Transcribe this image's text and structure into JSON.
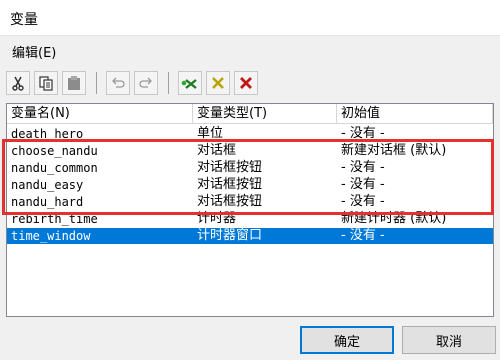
{
  "window": {
    "title": "变量"
  },
  "menu": {
    "edit": "编辑(E)"
  },
  "toolbar": {
    "buttons": [
      {
        "name": "cut-icon",
        "color": "#333333"
      },
      {
        "name": "copy-icon",
        "color": "#333333"
      },
      {
        "name": "paste-icon",
        "color": "#909090"
      },
      {
        "name": "undo-icon",
        "color": "#9a9a9a"
      },
      {
        "name": "redo-icon",
        "color": "#9a9a9a"
      },
      {
        "name": "new-variable-icon",
        "color": "#2a8a2a"
      },
      {
        "name": "delete-variable-icon",
        "color": "#b8a400"
      },
      {
        "name": "clear-icon",
        "color": "#c01818"
      }
    ]
  },
  "table": {
    "columns": [
      "变量名(N)",
      "变量类型(T)",
      "初始值"
    ],
    "rows": [
      {
        "name": "death_hero",
        "type": "单位",
        "initial": "- 没有 -",
        "selected": false
      },
      {
        "name": "choose_nandu",
        "type": "对话框",
        "initial": "新建对话框 (默认)",
        "selected": false
      },
      {
        "name": "nandu_common",
        "type": "对话框按钮",
        "initial": "- 没有 -",
        "selected": false
      },
      {
        "name": "nandu_easy",
        "type": "对话框按钮",
        "initial": "- 没有 -",
        "selected": false
      },
      {
        "name": "nandu_hard",
        "type": "对话框按钮",
        "initial": "- 没有 -",
        "selected": false
      },
      {
        "name": "rebirth_time",
        "type": "计时器",
        "initial": "新建计时器 (默认)",
        "selected": false
      },
      {
        "name": "time_window",
        "type": "计时器窗口",
        "initial": "- 没有 -",
        "selected": true
      }
    ]
  },
  "buttons": {
    "ok": "确定",
    "cancel": "取消"
  },
  "colors": {
    "selection": "#0078d7",
    "highlight_box": "#e53030"
  }
}
